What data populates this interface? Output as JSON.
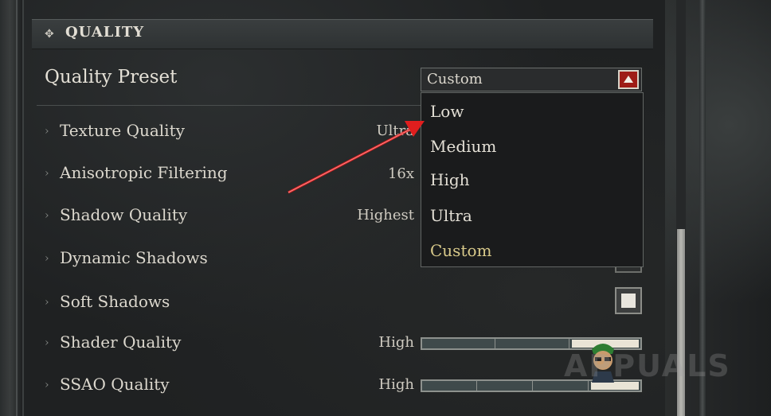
{
  "section": {
    "title": "QUALITY",
    "icon": "diamond-dots-icon"
  },
  "quality_preset": {
    "label": "Quality Preset",
    "selected": "Custom",
    "options": [
      "Low",
      "Medium",
      "High",
      "Ultra",
      "Custom"
    ]
  },
  "settings": [
    {
      "label": "Texture Quality",
      "value": "Ultra",
      "control": "dropdown"
    },
    {
      "label": "Anisotropic Filtering",
      "value": "16x",
      "control": "dropdown"
    },
    {
      "label": "Shadow Quality",
      "value": "Highest",
      "control": "dropdown"
    },
    {
      "label": "Dynamic Shadows",
      "value": "",
      "control": "checkbox",
      "checked": true
    },
    {
      "label": "Soft Shadows",
      "value": "",
      "control": "checkbox",
      "checked": true
    },
    {
      "label": "Shader Quality",
      "value": "High",
      "control": "slider",
      "level": 0.75
    },
    {
      "label": "SSAO Quality",
      "value": "High",
      "control": "slider",
      "level": 0.75
    }
  ],
  "watermark": "APPUALS",
  "colors": {
    "accent_red": "#9e1d17",
    "annotation_arrow": "#e01e1e",
    "custom_option": "#d8c98a"
  }
}
